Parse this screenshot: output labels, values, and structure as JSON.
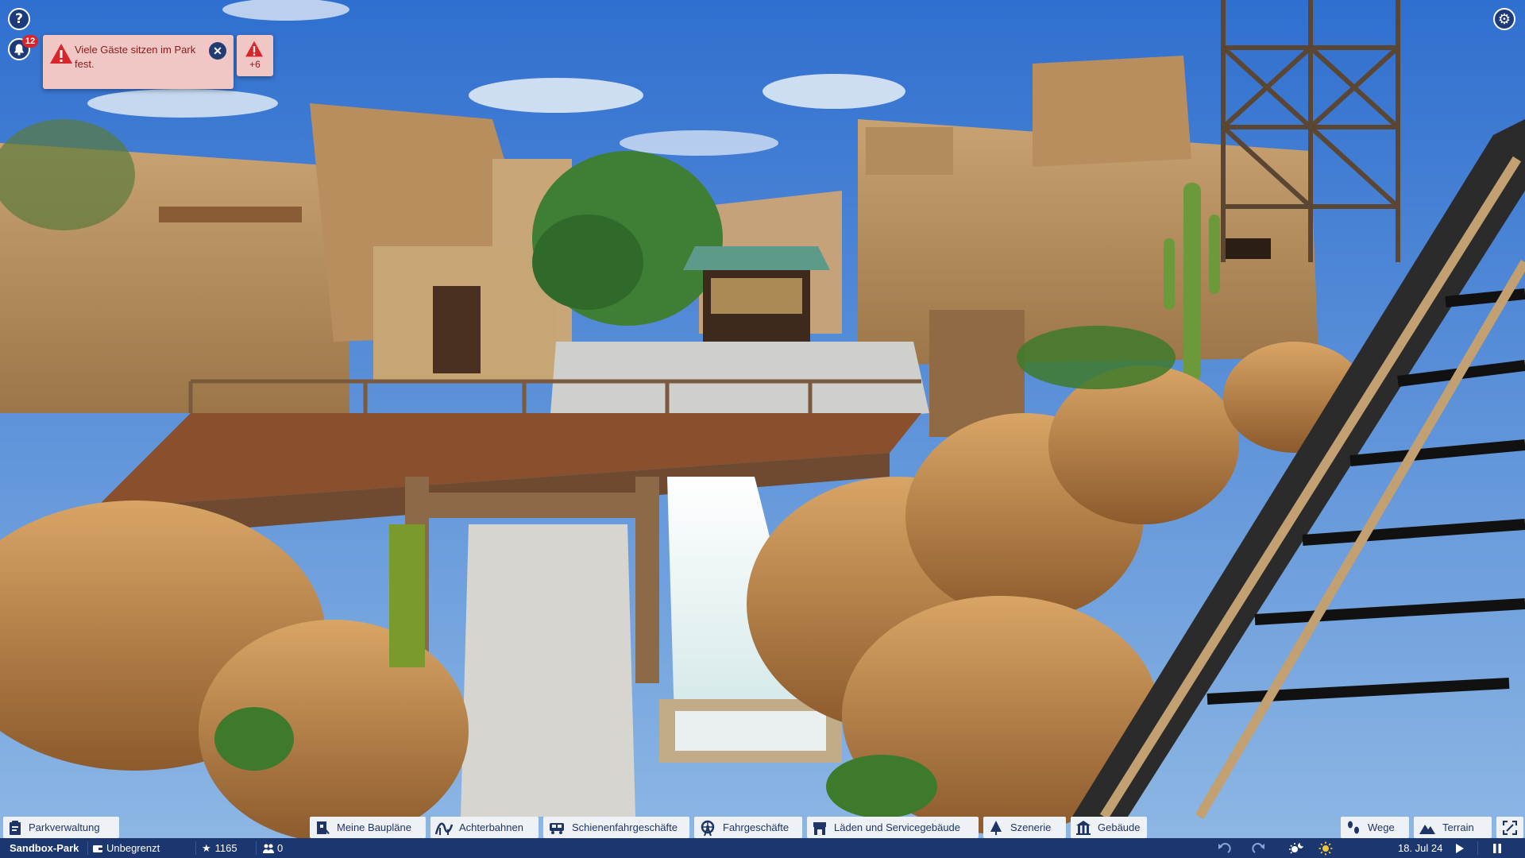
{
  "hud": {
    "help_icon": "?",
    "settings_icon": "⚙",
    "notification_count": "12"
  },
  "alert": {
    "message": "Viele Gäste sitzen im Park fest.",
    "close_icon": "✕",
    "more_count": "+6"
  },
  "toolbar": {
    "park_management": "Parkverwaltung",
    "blueprints": "Meine Baupläne",
    "coasters": "Achterbahnen",
    "track_rides": "Schienenfahrgeschäfte",
    "flat_rides": "Fahrgeschäfte",
    "shops": "Läden und Servicegebäude",
    "scenery": "Szenerie",
    "buildings": "Gebäude",
    "paths": "Wege",
    "terrain": "Terrain"
  },
  "status": {
    "park_name": "Sandbox-Park",
    "money": "Unbegrenzt",
    "rating": "1165",
    "guests": "0",
    "date": "18. Jul 24"
  },
  "colors": {
    "hud_blue": "#1c3670",
    "toolbar_bg": "#eef1f6",
    "alert_bg": "#f0c7c4",
    "alert_red": "#d8262a"
  }
}
